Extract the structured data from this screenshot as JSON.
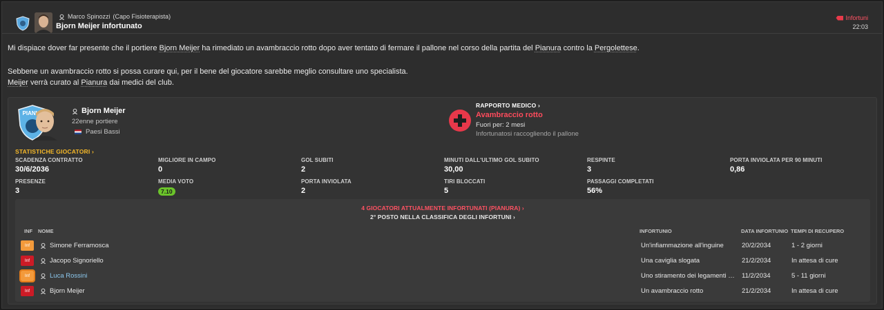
{
  "header": {
    "sender_name": "Marco Spinozzi",
    "sender_role": "(Capo Fisioterapista)",
    "subject": "Bjorn Meijer infortunato",
    "category": "Infortuni",
    "time": "22:03"
  },
  "message": {
    "p1_a": "Mi dispiace dover far presente che il portiere ",
    "p1_player": "Bjorn Meijer",
    "p1_b": " ha rimediato un avambraccio rotto dopo aver tentato di fermare il pallone nel corso della partita del ",
    "p1_club": "Pianura",
    "p1_c": " contro la ",
    "p1_opp": "Pergolettese",
    "p1_d": ".",
    "p2": "Sebbene un avambraccio rotto si possa curare qui, per il bene del giocatore sarebbe meglio consultare uno specialista.",
    "p3_player": "Meijer",
    "p3_a": " verrà curato al ",
    "p3_club": "Pianura",
    "p3_b": " dai medici del club."
  },
  "player": {
    "name": "Bjorn Meijer",
    "age_position": "22enne portiere",
    "nationality": "Paesi Bassi",
    "badge_text": "PIANU"
  },
  "medical": {
    "title": "RAPPORTO MEDICO ›",
    "injury": "Avambraccio rotto",
    "out_for": "Fuori per: 2 mesi",
    "how": "Infortunatosi raccogliendo il pallone"
  },
  "stats": {
    "link": "STATISTICHE GIOCATORI ›",
    "items": [
      {
        "label": "SCADENZA CONTRATTO",
        "value": "30/6/2036"
      },
      {
        "label": "MIGLIORE IN CAMPO",
        "value": "0"
      },
      {
        "label": "GOL SUBITI",
        "value": "2"
      },
      {
        "label": "MINUTI DALL'ULTIMO GOL SUBITO",
        "value": "30,00"
      },
      {
        "label": "RESPINTE",
        "value": "3"
      },
      {
        "label": "PORTA INVIOLATA PER 90 MINUTI",
        "value": "0,86"
      },
      {
        "label": "PRESENZE",
        "value": "3"
      },
      {
        "label": "MEDIA VOTO",
        "value": "7.10"
      },
      {
        "label": "PORTA INVIOLATA",
        "value": "2"
      },
      {
        "label": "TIRI BLOCCATI",
        "value": "5"
      },
      {
        "label": "PASSAGGI COMPLETATI",
        "value": "56%"
      }
    ]
  },
  "injury_list": {
    "count_link": "4 GIOCATORI ATTUALMENTE INFORTUNATI (PIANURA) ›",
    "rank_link": "2° POSTO NELLA CLASSIFICA DEGLI INFORTUNI ›",
    "columns": {
      "inf": "INF",
      "name": "NOME",
      "injury": "INFORTUNIO",
      "date": "DATA INFORTUNIO",
      "recovery": "TEMPI DI RECUPERO"
    },
    "rows": [
      {
        "chip": "Inf",
        "name": "Simone Ferramosca",
        "injury": "Un'infiammazione all'inguine",
        "date": "20/2/2034",
        "recovery": "1 - 2 giorni"
      },
      {
        "chip": "Inf",
        "name": "Jacopo Signoriello",
        "injury": "Una caviglia slogata",
        "date": "21/2/2034",
        "recovery": "In attesa di cure"
      },
      {
        "chip": "Inf",
        "name": "Luca Rossini",
        "injury": "Uno stiramento dei legamenti de...",
        "date": "11/2/2034",
        "recovery": "5 - 11 giorni"
      },
      {
        "chip": "Inf",
        "name": "Bjorn Meijer",
        "injury": "Un avambraccio rotto",
        "date": "21/2/2034",
        "recovery": "In attesa di cure"
      }
    ]
  },
  "colors": {
    "accent_red": "#ff4b5c",
    "accent_yellow": "#f7b928",
    "link_blue": "#8cc8ee",
    "rating_green": "#6bc42a"
  }
}
